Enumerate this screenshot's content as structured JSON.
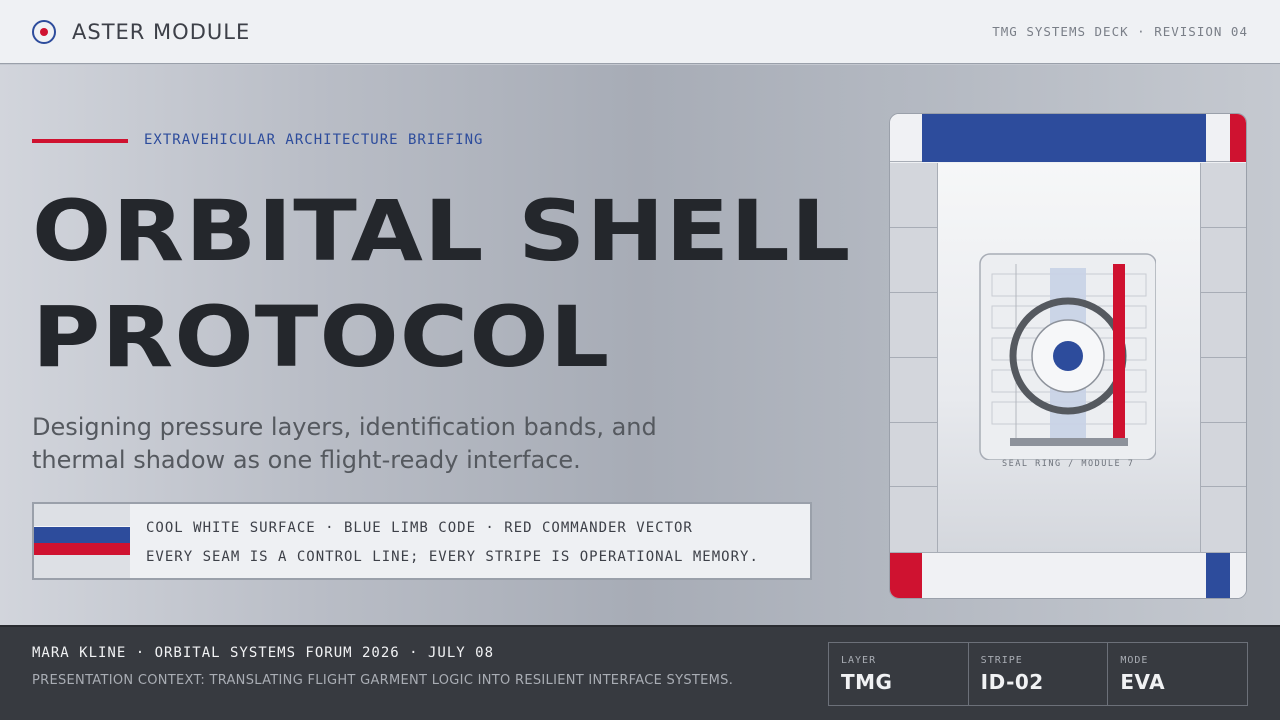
{
  "header": {
    "brand": "ASTER MODULE",
    "logo_icon": "target-icon",
    "deck_meta": "TMG SYSTEMS DECK · REVISION 04"
  },
  "hero": {
    "kicker": "EXTRAVEHICULAR ARCHITECTURE BRIEFING",
    "title_line1": "ORBITAL SHELL",
    "title_line2": "PROTOCOL",
    "subtitle": "Designing pressure layers, identification bands, and thermal shadow as one flight-ready interface."
  },
  "code_box": {
    "line1": "COOL WHITE SURFACE · BLUE LIMB CODE · RED COMMANDER VECTOR",
    "line2": "EVERY SEAM IS A CONTROL LINE; EVERY STRIPE IS OPERATIONAL MEMORY."
  },
  "panel": {
    "caption": "SEAL RING / MODULE 7"
  },
  "footer": {
    "presenter": "MARA KLINE · ORBITAL SYSTEMS FORUM 2026 · JULY 08",
    "context": "PRESENTATION CONTEXT: TRANSLATING FLIGHT GARMENT LOGIC INTO RESILIENT INTERFACE SYSTEMS.",
    "stats": [
      {
        "label": "LAYER",
        "value": "TMG"
      },
      {
        "label": "STRIPE",
        "value": "ID-02"
      },
      {
        "label": "MODE",
        "value": "EVA"
      }
    ]
  },
  "colors": {
    "accent_blue": "#2d4c9c",
    "accent_red": "#cf1230",
    "ink": "#24272c",
    "footer_bg": "#373a40"
  }
}
